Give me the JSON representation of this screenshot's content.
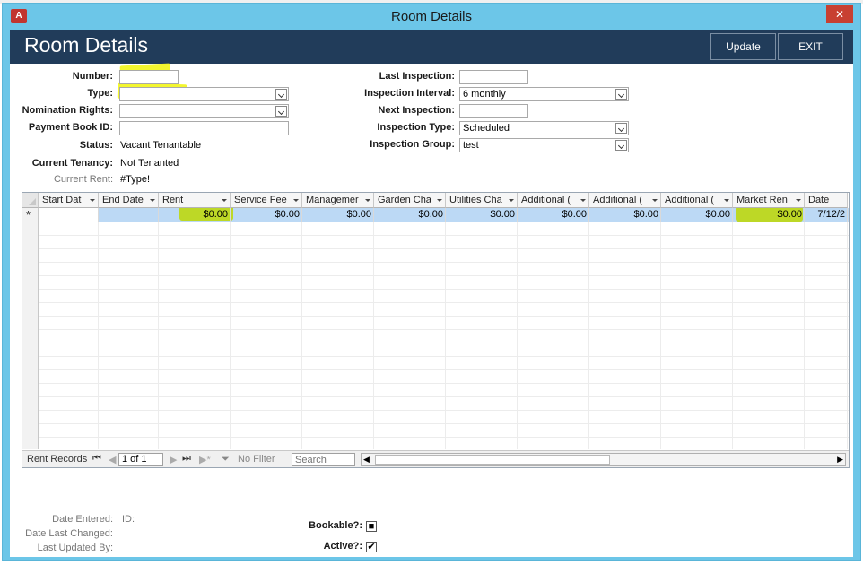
{
  "window": {
    "app_icon": "A",
    "title": "Room Details",
    "close": "✕"
  },
  "header": {
    "title": "Room Details",
    "update_label": "Update",
    "exit_label": "EXIT"
  },
  "form_left": {
    "number_label": "Number:",
    "number_value": "",
    "type_label": "Type:",
    "type_value": "",
    "nomination_label": "Nomination Rights:",
    "nomination_value": "",
    "payment_book_label": "Payment Book ID:",
    "payment_book_value": "",
    "status_label": "Status:",
    "status_value": "Vacant Tenantable",
    "current_tenancy_label": "Current Tenancy:",
    "current_tenancy_value": "Not Tenanted",
    "current_rent_label": "Current Rent:",
    "current_rent_value": "#Type!"
  },
  "form_right": {
    "last_inspection_label": "Last Inspection:",
    "last_inspection_value": "",
    "inspection_interval_label": "Inspection Interval:",
    "inspection_interval_value": "6 monthly",
    "next_inspection_label": "Next Inspection:",
    "next_inspection_value": "",
    "inspection_type_label": "Inspection Type:",
    "inspection_type_value": "Scheduled",
    "inspection_group_label": "Inspection Group:",
    "inspection_group_value": "test"
  },
  "datasheet": {
    "columns": [
      "Start Dat",
      "End Date",
      "Rent",
      "Service Fee",
      "Managemer",
      "Garden Cha",
      "Utilities Cha",
      "Additional (",
      "Additional (",
      "Additional (",
      "Market Ren",
      "Date"
    ],
    "new_row_marker": "*",
    "new_row": [
      "",
      "",
      "$0.00",
      "$0.00",
      "$0.00",
      "$0.00",
      "$0.00",
      "$0.00",
      "$0.00",
      "$0.00",
      "$0.00",
      "7/12/2"
    ]
  },
  "navigation": {
    "record_label": "Rent Records",
    "first": "⏮",
    "prev": "◀",
    "position": "1 of 1",
    "next": "▶",
    "last": "⏭",
    "new": "▶*",
    "filter_label": "No Filter",
    "search_placeholder": "Search",
    "scroll_left": "◀",
    "scroll_right": "▶"
  },
  "footer": {
    "date_entered_label": "Date Entered:",
    "id_label": "ID:",
    "date_last_changed_label": "Date Last Changed:",
    "last_updated_by_label": "Last Updated By:",
    "bookable_label": "Bookable?:",
    "bookable_mark": "■",
    "active_label": "Active?:",
    "active_mark": "✔"
  },
  "colors": {
    "window_frame": "#6cc6e8",
    "header": "#213c5a",
    "highlight_yellow": "#f2f518",
    "highlight_green": "#bcd70f",
    "new_row": "#bcd9f5",
    "close": "#c84031"
  }
}
